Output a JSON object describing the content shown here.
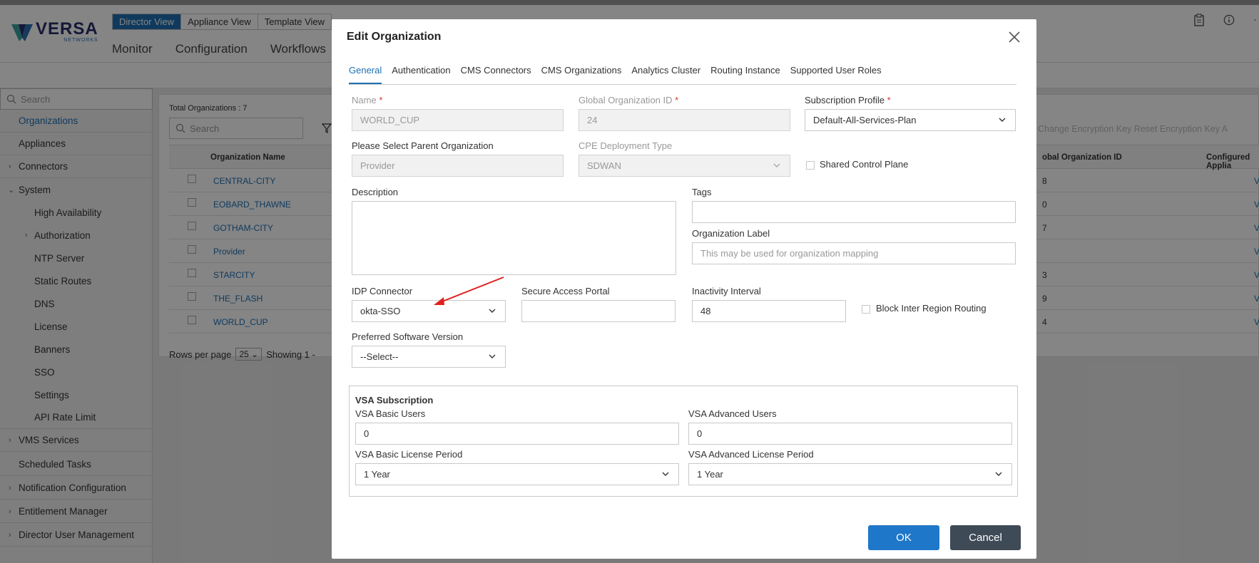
{
  "header": {
    "logo": "VERSA",
    "logo_sub": "NETWORKS",
    "view_tabs": [
      "Director View",
      "Appliance View",
      "Template View"
    ],
    "nav": [
      "Monitor",
      "Configuration",
      "Workflows"
    ]
  },
  "sidebar": {
    "search_placeholder": "Search",
    "items": [
      {
        "label": "Organizations",
        "active": true
      },
      {
        "label": "Appliances"
      },
      {
        "label": "Connectors",
        "expandable": true
      },
      {
        "label": "System",
        "expanded": true
      },
      {
        "label": "High Availability"
      },
      {
        "label": "Authorization",
        "expandable": true
      },
      {
        "label": "NTP Server"
      },
      {
        "label": "Static Routes"
      },
      {
        "label": "DNS"
      },
      {
        "label": "License"
      },
      {
        "label": "Banners"
      },
      {
        "label": "SSO"
      },
      {
        "label": "Settings"
      },
      {
        "label": "API Rate Limit"
      },
      {
        "label": "VMS Services",
        "expandable": true
      },
      {
        "label": "Scheduled Tasks"
      },
      {
        "label": "Notification Configuration",
        "expandable": true
      },
      {
        "label": "Entitlement Manager",
        "expandable": true
      },
      {
        "label": "Director User Management",
        "expandable": true
      }
    ]
  },
  "orgs": {
    "total": "Total Organizations : 7",
    "search_placeholder": "Search",
    "toolbar_right": "Change Encryption Key   Reset Encryption Key   A",
    "columns": [
      "Organization Name",
      "obal Organization ID",
      "Configured Applia"
    ],
    "rows": [
      {
        "name": "CENTRAL-CITY",
        "gid": "8",
        "view": "Vi"
      },
      {
        "name": "EOBARD_THAWNE",
        "gid": "0",
        "view": "Vi"
      },
      {
        "name": "GOTHAM-CITY",
        "gid": "7",
        "view": "Vi"
      },
      {
        "name": "Provider",
        "gid": "",
        "view": "Vi"
      },
      {
        "name": "STARCITY",
        "gid": "3",
        "view": "Vi"
      },
      {
        "name": "THE_FLASH",
        "gid": "9",
        "view": "Vi"
      },
      {
        "name": "WORLD_CUP",
        "gid": "4",
        "view": "Vi"
      }
    ],
    "rows_per_page_label": "Rows per page",
    "rows_per_page": "25",
    "showing": "Showing  1  -"
  },
  "modal": {
    "title": "Edit Organization",
    "tabs": [
      "General",
      "Authentication",
      "CMS Connectors",
      "CMS Organizations",
      "Analytics Cluster",
      "Routing Instance",
      "Supported User Roles"
    ],
    "active_tab": "General",
    "name_label": "Name",
    "name_value": "WORLD_CUP",
    "gid_label": "Global Organization ID",
    "gid_value": "24",
    "sub_profile_label": "Subscription Profile",
    "sub_profile_value": "Default-All-Services-Plan",
    "parent_label": "Please Select Parent Organization",
    "parent_value": "Provider",
    "cpe_label": "CPE Deployment Type",
    "cpe_value": "SDWAN",
    "shared_cp_label": "Shared Control Plane",
    "description_label": "Description",
    "tags_label": "Tags",
    "org_label_label": "Organization Label",
    "org_label_placeholder": "This may be used for organization mapping",
    "idp_label": "IDP Connector",
    "idp_value": "okta-SSO",
    "sap_label": "Secure Access Portal",
    "inactivity_label": "Inactivity Interval",
    "inactivity_value": "48",
    "block_label": "Block Inter Region Routing",
    "psv_label": "Preferred Software Version",
    "psv_value": "--Select--",
    "vsa_title": "VSA Subscription",
    "vsa_basic_label": "VSA Basic Users",
    "vsa_basic_value": "0",
    "vsa_adv_label": "VSA Advanced Users",
    "vsa_adv_value": "0",
    "vsa_basic_period_label": "VSA Basic License Period",
    "vsa_basic_period_value": "1 Year",
    "vsa_adv_period_label": "VSA Advanced License Period",
    "vsa_adv_period_value": "1 Year",
    "ok": "OK",
    "cancel": "Cancel",
    "required_mark": "*"
  },
  "colors": {
    "accent": "#1f6fb2",
    "ok": "#1f77c9",
    "cancel": "#3e4a56",
    "arrow": "#e02020"
  }
}
